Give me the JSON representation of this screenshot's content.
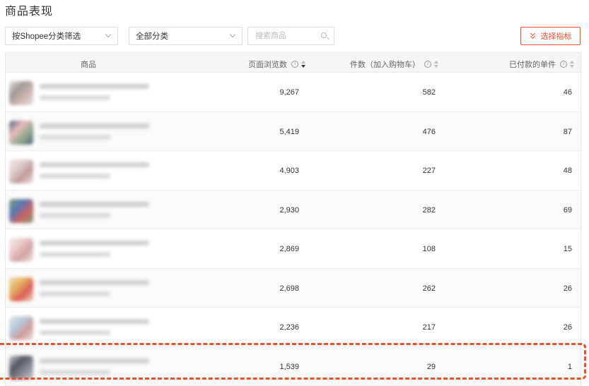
{
  "page_title": "商品表现",
  "filters": {
    "shopee_filter": "按Shopee分类筛选",
    "category_filter": "全部分类",
    "search_placeholder": "搜索商品",
    "select_metrics_label": "选择指标"
  },
  "table": {
    "columns": {
      "product": "商品",
      "page_views": "页面浏览数",
      "items_added_to_cart": "件数（加入购物车）",
      "paid_units": "已付款的单件"
    },
    "rows": [
      {
        "page_views": "9,267",
        "items_added_to_cart": "582",
        "paid_units": "46",
        "thumb_colors": [
          "#8f8a88",
          "#c9a9a6",
          "#e4dcd8"
        ]
      },
      {
        "page_views": "5,419",
        "items_added_to_cart": "476",
        "paid_units": "87",
        "thumb_colors": [
          "#e7b0b0",
          "#7d9b7a",
          "#334a6a"
        ]
      },
      {
        "page_views": "4,903",
        "items_added_to_cart": "227",
        "paid_units": "48",
        "thumb_colors": [
          "#d9c4c4",
          "#b58a8a",
          "#f0e4e4"
        ]
      },
      {
        "page_views": "2,930",
        "items_added_to_cart": "282",
        "paid_units": "69",
        "thumb_colors": [
          "#3c63a8",
          "#c24a4a",
          "#6d8f5a"
        ]
      },
      {
        "page_views": "2,869",
        "items_added_to_cart": "108",
        "paid_units": "15",
        "thumb_colors": [
          "#e8c2c2",
          "#c99393",
          "#f5e6e6"
        ]
      },
      {
        "page_views": "2,698",
        "items_added_to_cart": "262",
        "paid_units": "26",
        "thumb_colors": [
          "#e0a646",
          "#d8433c",
          "#f0d9a8"
        ]
      },
      {
        "page_views": "2,236",
        "items_added_to_cart": "217",
        "paid_units": "26",
        "thumb_colors": [
          "#a9c3d8",
          "#c78a8a",
          "#e7e0d8"
        ]
      },
      {
        "page_views": "1,539",
        "items_added_to_cart": "29",
        "paid_units": "1",
        "thumb_colors": [
          "#3a3a48",
          "#7a7a88",
          "#c0c0c8"
        ]
      }
    ]
  },
  "colors": {
    "accent": "#ee4d2d",
    "highlight": "#e8512a"
  }
}
